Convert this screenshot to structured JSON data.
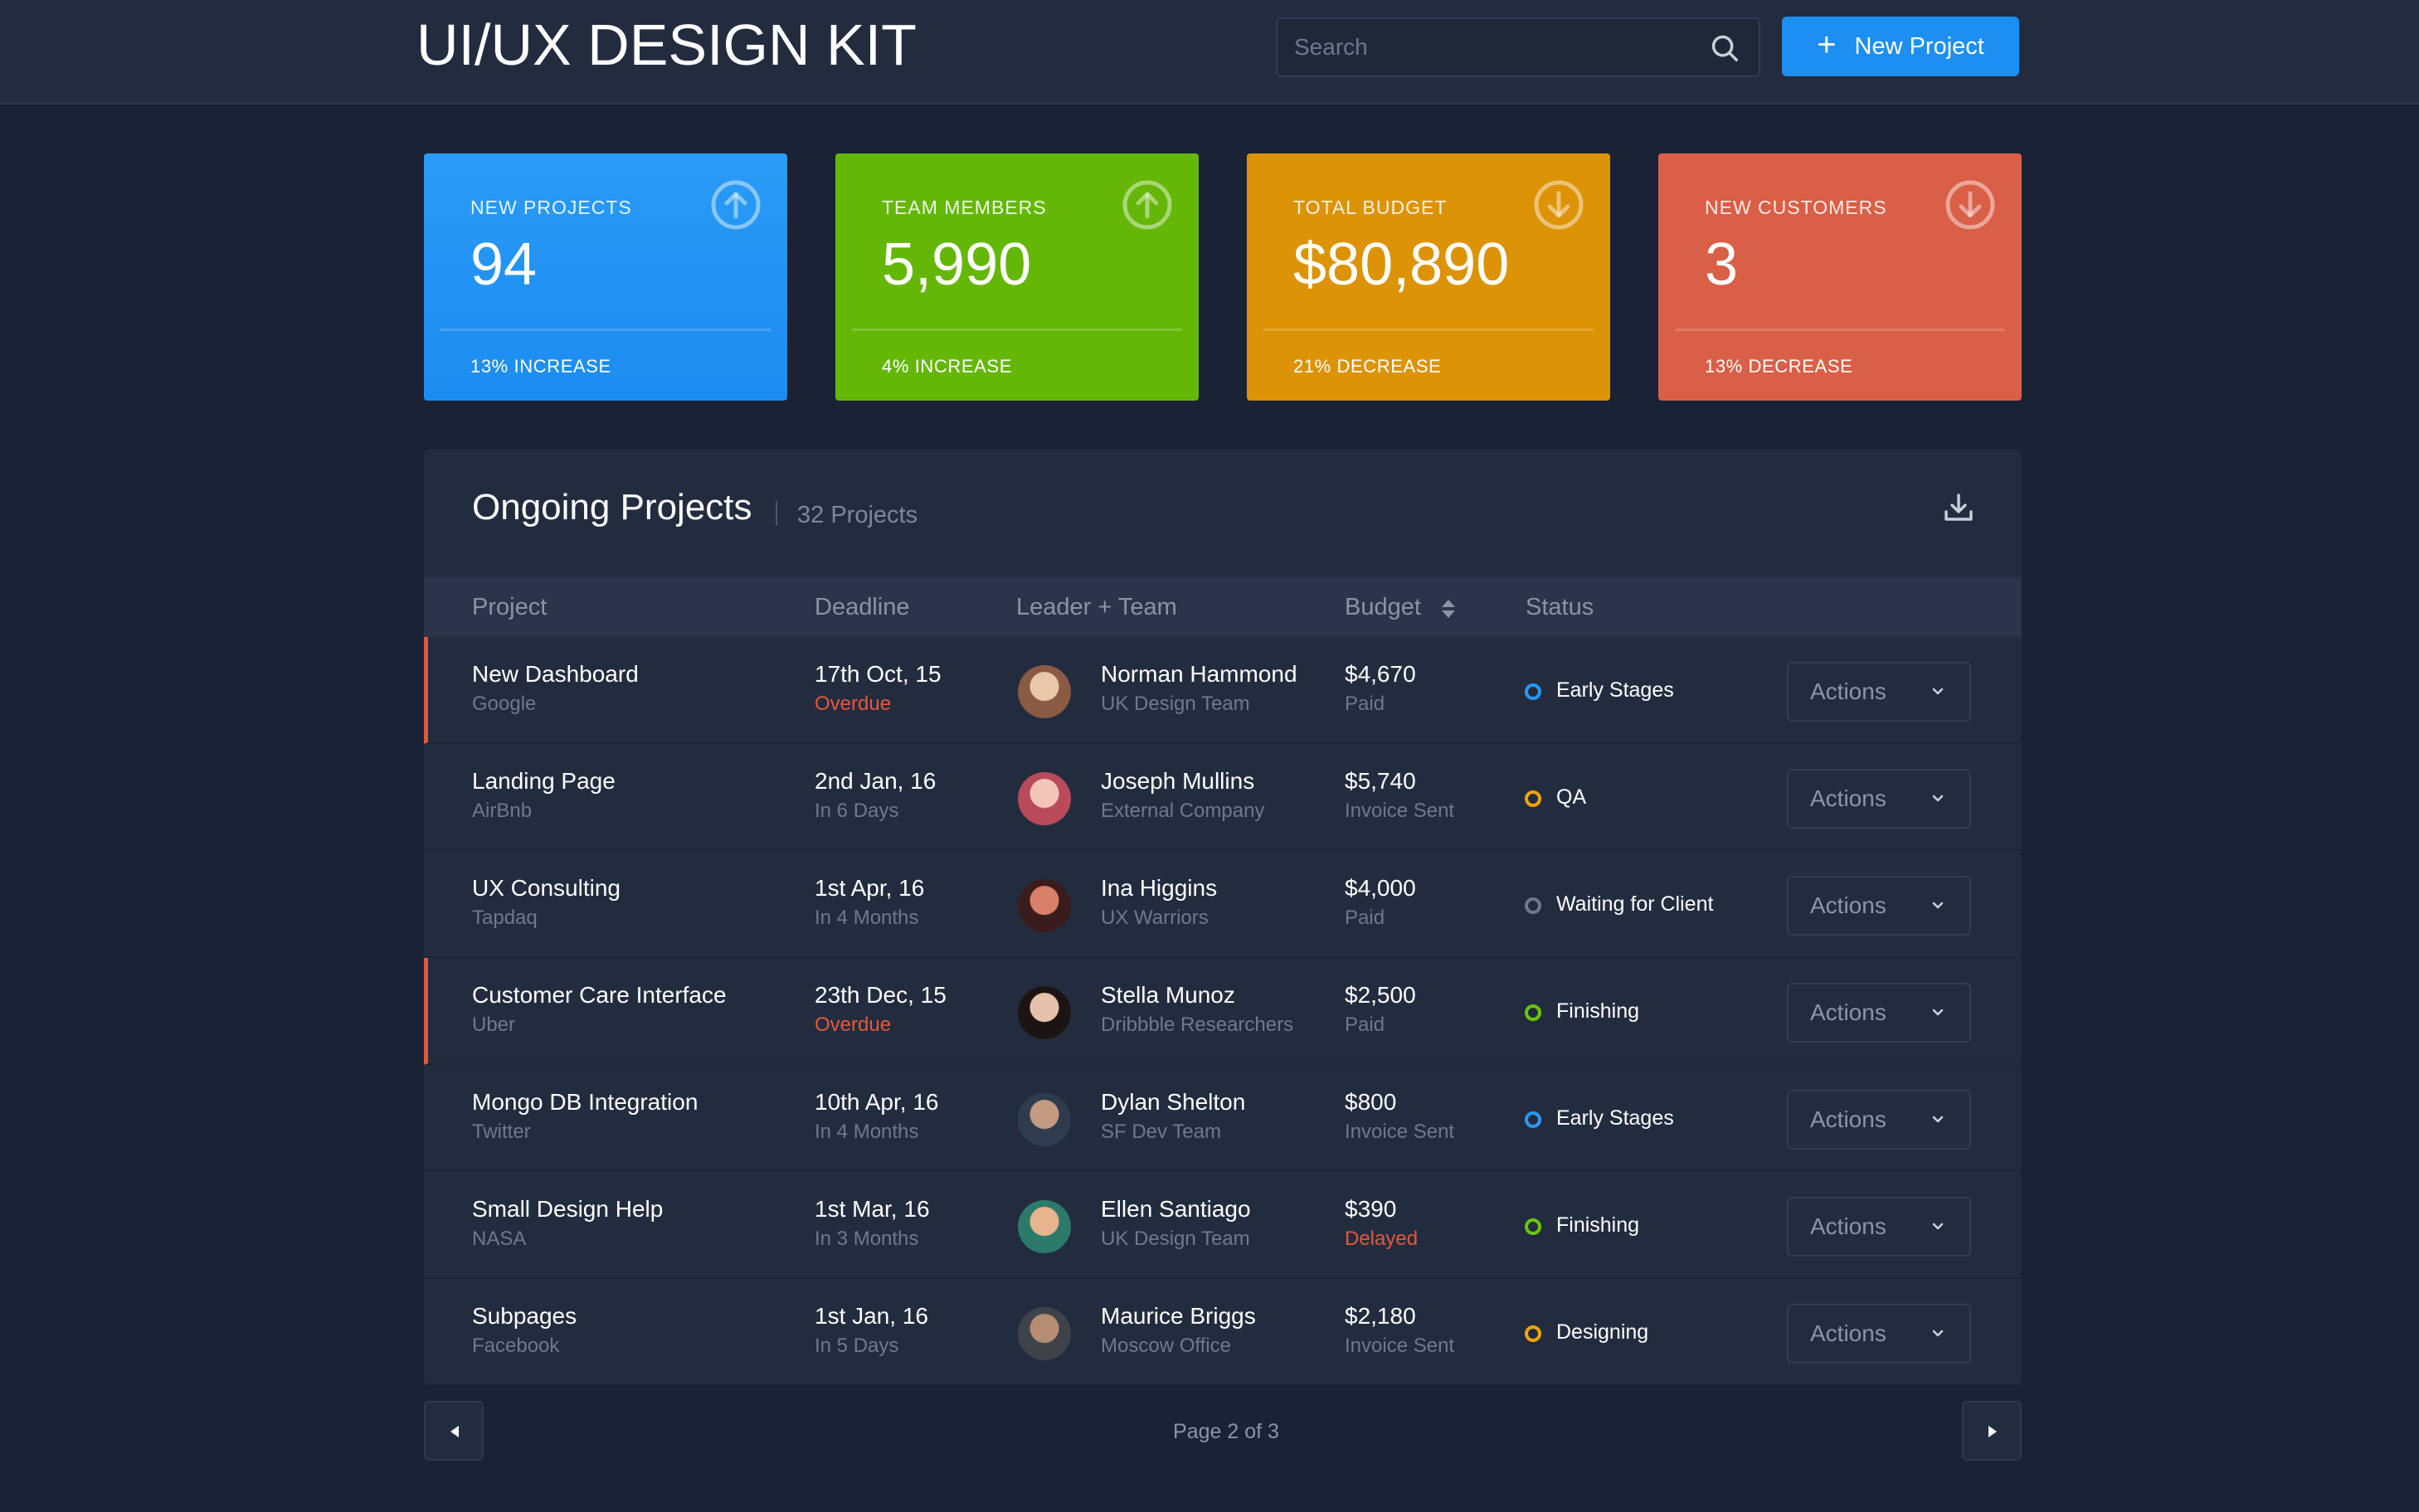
{
  "header": {
    "title": "UI/UX DESIGN KIT",
    "search_placeholder": "Search",
    "new_project_label": "New Project",
    "accent_color": "#1d8ef2"
  },
  "stats": [
    {
      "label": "NEW PROJECTS",
      "value": "94",
      "change": "13% INCREASE",
      "trend_icon": "arrow-up-circle-icon",
      "color": "#1f90f2"
    },
    {
      "label": "TEAM MEMBERS",
      "value": "5,990",
      "change": "4% INCREASE",
      "trend_icon": "arrow-up-circle-icon",
      "color": "#64b707"
    },
    {
      "label": "TOTAL BUDGET",
      "value": "$80,890",
      "change": "21% DECREASE",
      "trend_icon": "arrow-down-circle-icon",
      "color": "#dc9306"
    },
    {
      "label": "NEW CUSTOMERS",
      "value": "3",
      "change": "13% DECREASE",
      "trend_icon": "arrow-down-circle-icon",
      "color": "#d95f46"
    }
  ],
  "projects": {
    "title": "Ongoing Projects",
    "count": "32 Projects",
    "columns": [
      "Project",
      "Deadline",
      "Leader + Team",
      "Budget",
      "Status"
    ],
    "actions_label": "Actions",
    "rows": [
      {
        "name": "New Dashboard",
        "client": "Google",
        "deadline": "17th Oct, 15",
        "deadline_note": "Overdue",
        "leader": "Norman Hammond",
        "team": "UK Design Team",
        "budget": "$4,670",
        "budget_note": "Paid",
        "status": "Early Stages",
        "status_color": "#2b97f4",
        "flagged": true
      },
      {
        "name": "Landing Page",
        "client": "AirBnb",
        "deadline": "2nd Jan, 16",
        "deadline_note": "In 6 Days",
        "leader": "Joseph Mullins",
        "team": "External Company",
        "budget": "$5,740",
        "budget_note": "Invoice Sent",
        "status": "QA",
        "status_color": "#f0a30a",
        "flagged": false
      },
      {
        "name": "UX Consulting",
        "client": "Tapdaq",
        "deadline": "1st Apr, 16",
        "deadline_note": "In 4 Months",
        "leader": "Ina Higgins",
        "team": "UX Warriors",
        "budget": "$4,000",
        "budget_note": "Paid",
        "status": "Waiting for Client",
        "status_color": "#6f798c",
        "flagged": false
      },
      {
        "name": "Customer Care Interface",
        "client": "Uber",
        "deadline": "23th Dec, 15",
        "deadline_note": "Overdue",
        "leader": "Stella Munoz",
        "team": "Dribbble Researchers",
        "budget": "$2,500",
        "budget_note": "Paid",
        "status": "Finishing",
        "status_color": "#69c50a",
        "flagged": true
      },
      {
        "name": "Mongo DB Integration",
        "client": "Twitter",
        "deadline": "10th Apr, 16",
        "deadline_note": "In 4 Months",
        "leader": "Dylan Shelton",
        "team": "SF Dev Team",
        "budget": "$800",
        "budget_note": "Invoice Sent",
        "status": "Early Stages",
        "status_color": "#2b97f4",
        "flagged": false
      },
      {
        "name": "Small Design Help",
        "client": "NASA",
        "deadline": "1st Mar, 16",
        "deadline_note": "In 3 Months",
        "leader": "Ellen Santiago",
        "team": "UK Design Team",
        "budget": "$390",
        "budget_note": "Delayed",
        "status": "Finishing",
        "status_color": "#69c50a",
        "flagged": false
      },
      {
        "name": "Subpages",
        "client": "Facebook",
        "deadline": "1st Jan, 16",
        "deadline_note": "In 5 Days",
        "leader": "Maurice Briggs",
        "team": "Moscow Office",
        "budget": "$2,180",
        "budget_note": "Invoice Sent",
        "status": "Designing",
        "status_color": "#f0a30a",
        "flagged": false
      }
    ]
  },
  "pagination": {
    "label": "Page 2 of 3"
  },
  "warning_color": "#e2583d"
}
